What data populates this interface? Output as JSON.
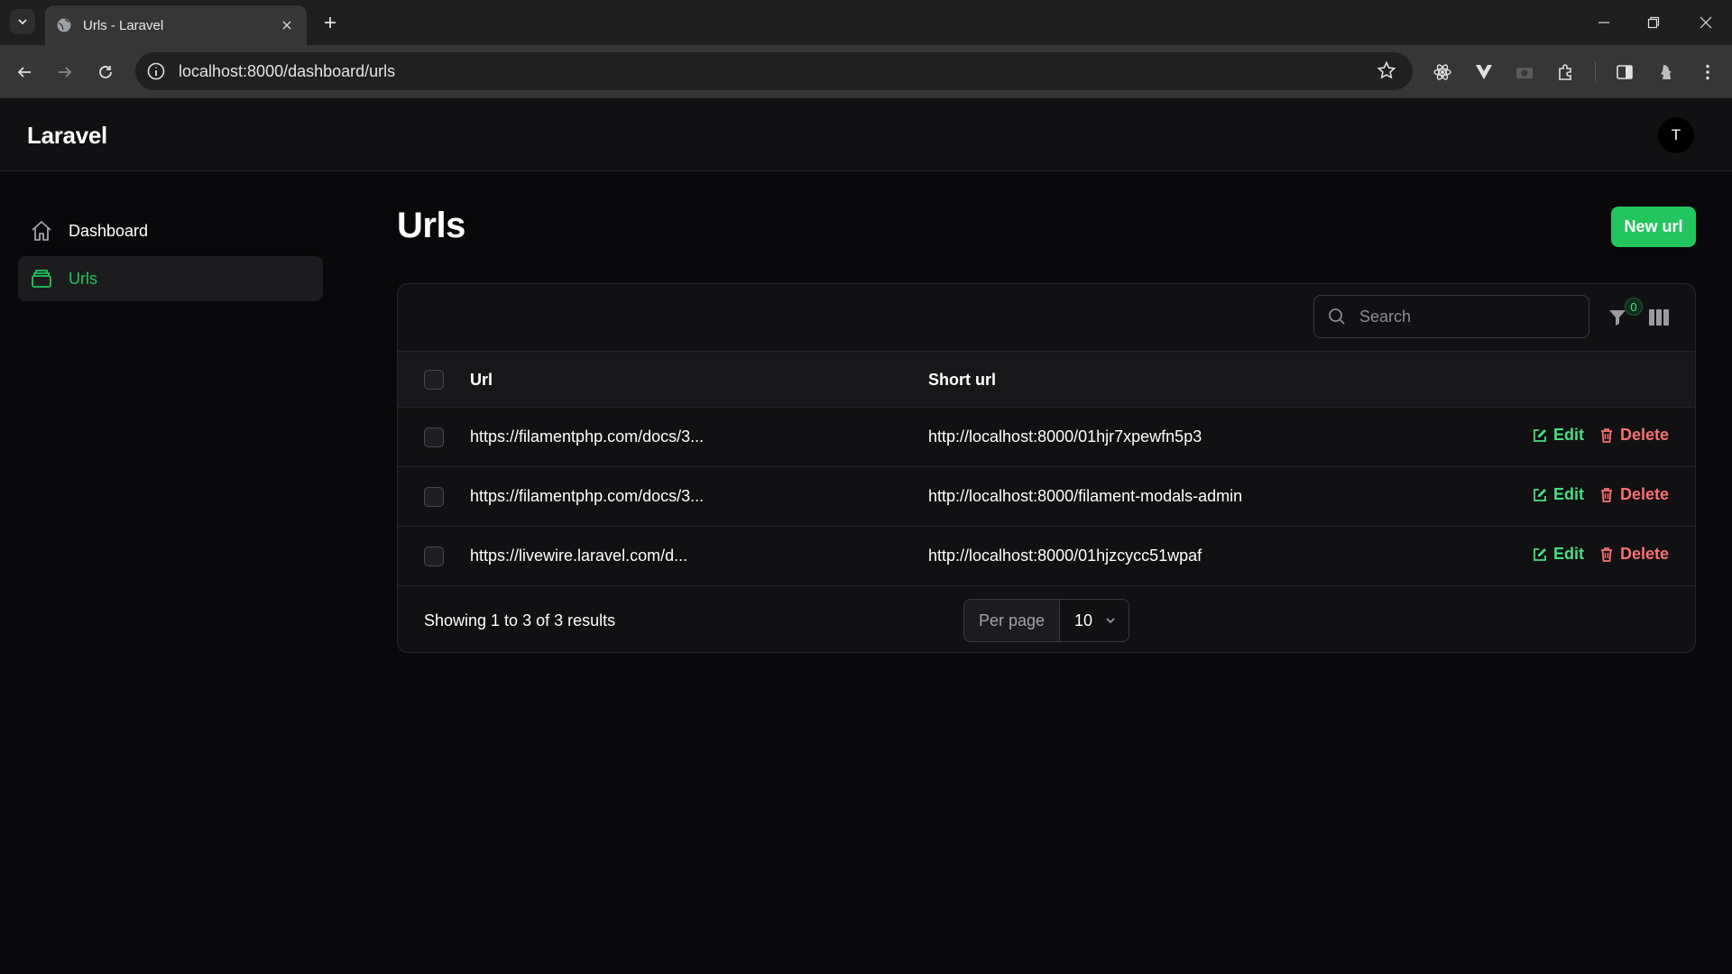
{
  "browser": {
    "tab_title": "Urls - Laravel",
    "url": "localhost:8000/dashboard/urls"
  },
  "app": {
    "brand": "Laravel",
    "avatar_initial": "T"
  },
  "sidebar": {
    "items": [
      {
        "label": "Dashboard",
        "icon": "home-icon"
      },
      {
        "label": "Urls",
        "icon": "inbox-stack-icon",
        "active": true
      }
    ]
  },
  "page": {
    "title": "Urls",
    "new_button": "New url"
  },
  "table": {
    "search_placeholder": "Search",
    "filter_count": "0",
    "columns": [
      "Url",
      "Short url"
    ],
    "rows": [
      {
        "url": "https://filamentphp.com/docs/3...",
        "short_url": "http://localhost:8000/01hjr7xpewfn5p3",
        "edit": "Edit",
        "delete": "Delete"
      },
      {
        "url": "https://filamentphp.com/docs/3...",
        "short_url": "http://localhost:8000/filament-modals-admin",
        "edit": "Edit",
        "delete": "Delete"
      },
      {
        "url": "https://livewire.laravel.com/d...",
        "short_url": "http://localhost:8000/01hjzcycc51wpaf",
        "edit": "Edit",
        "delete": "Delete"
      }
    ],
    "summary": "Showing 1 to 3 of 3 results",
    "per_page_label": "Per page",
    "per_page_value": "10"
  },
  "colors": {
    "accent": "#22c55e",
    "danger": "#f87171",
    "background": "#09090b"
  }
}
